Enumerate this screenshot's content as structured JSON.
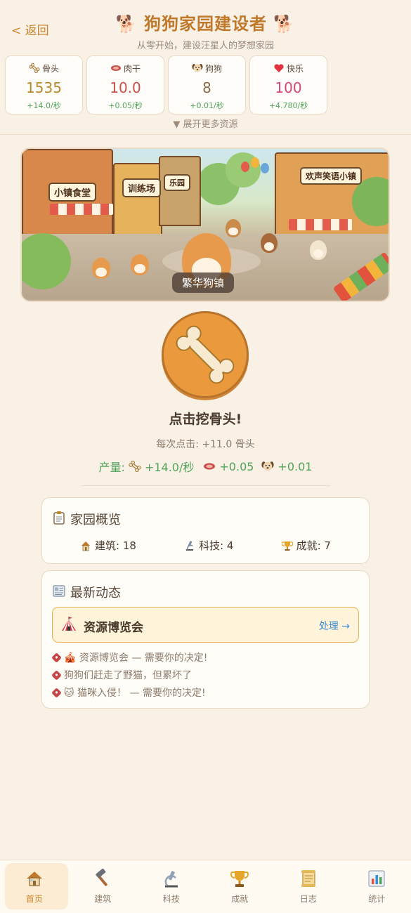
{
  "header": {
    "back_label": "< 返回",
    "title": "🐕 狗狗家园建设者 🐕",
    "subtitle": "从零开始，建设汪星人的梦想家园"
  },
  "resources": [
    {
      "icon": "bone-icon",
      "name": "骨头",
      "value": "1535",
      "rate": "+14.0/秒",
      "color": "#b8892c"
    },
    {
      "icon": "jerky-icon",
      "name": "肉干",
      "value": "10.0",
      "rate": "+0.05/秒",
      "color": "#c9504a"
    },
    {
      "icon": "dog-face-icon",
      "name": "狗狗",
      "value": "8",
      "rate": "+0.01/秒",
      "color": "#8a6a4a"
    },
    {
      "icon": "heart-icon",
      "name": "快乐",
      "value": "100",
      "rate": "+4.780/秒",
      "color": "#d6457a"
    }
  ],
  "expand_label": "▼ 展开更多资源",
  "banner": {
    "label": "繁华狗镇",
    "signs": [
      "小镇食堂",
      "训练场",
      "乐园",
      "欢声笑语小镇"
    ]
  },
  "clicker": {
    "title": "点击挖骨头!",
    "per_click": "每次点击: +11.0 骨头",
    "production_label": "产量:",
    "prod_bone": "+14.0/秒",
    "prod_meat": "+0.05",
    "prod_dog": "+0.01"
  },
  "overview": {
    "title": "家园概览",
    "buildings": "建筑: 18",
    "tech": "科技: 4",
    "achievements": "成就: 7"
  },
  "news": {
    "title": "最新动态",
    "event_name": "资源博览会",
    "event_action": "处理 →",
    "logs": [
      "🎪 资源博览会 — 需要你的决定!",
      "狗狗们赶走了野猫，但累坏了",
      "🐱 猫咪入侵！ — 需要你的决定!"
    ]
  },
  "nav": [
    {
      "icon": "home-icon",
      "label": "首页",
      "active": true
    },
    {
      "icon": "hammer-icon",
      "label": "建筑",
      "active": false
    },
    {
      "icon": "microscope-icon",
      "label": "科技",
      "active": false
    },
    {
      "icon": "trophy-icon",
      "label": "成就",
      "active": false
    },
    {
      "icon": "scroll-icon",
      "label": "日志",
      "active": false
    },
    {
      "icon": "bar-chart-icon",
      "label": "统计",
      "active": false
    }
  ],
  "colors": {
    "background": "#f9f1e6",
    "accent": "#c9862b",
    "positive": "#52a35a",
    "link": "#3b8ed6",
    "event_bg": "#fff3da",
    "event_border": "#e8b250"
  }
}
